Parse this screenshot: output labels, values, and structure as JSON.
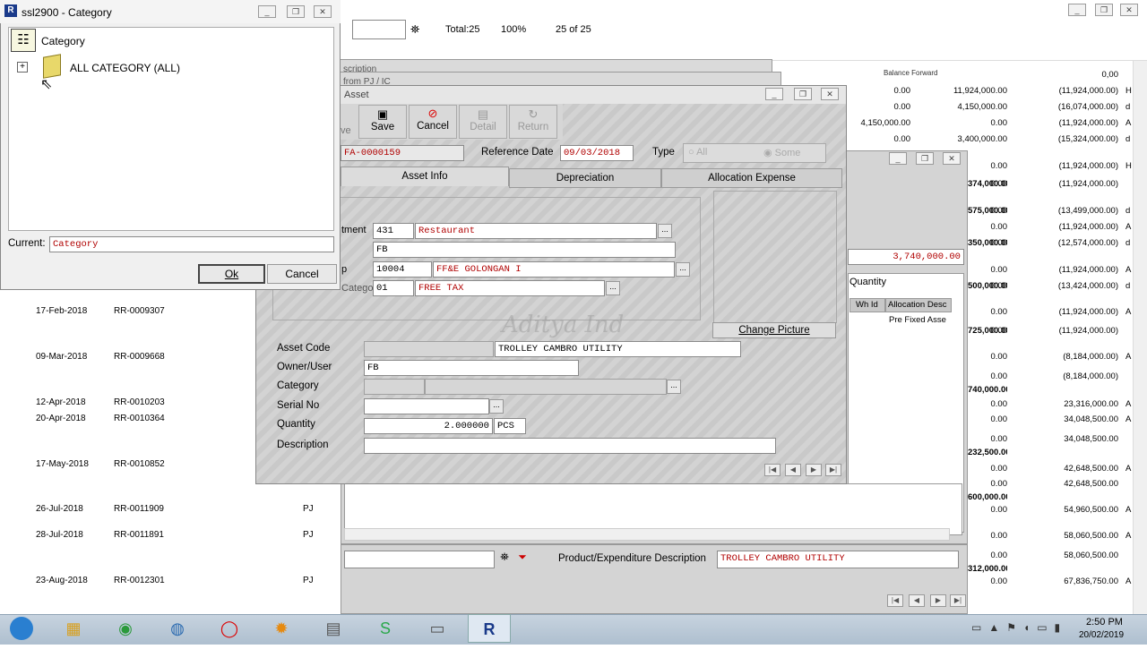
{
  "toolbar": {
    "total": "Total:25",
    "zoom": "100%",
    "page": "25 of 25"
  },
  "category_dialog": {
    "title": "ssl2900 - Category",
    "tree_root": "Category",
    "tree_node": "ALL CATEGORY (ALL)",
    "current_label": "Current:",
    "current_value": "Category",
    "ok": "Ok",
    "cancel": "Cancel"
  },
  "bg_windows": {
    "title1": "scription",
    "title2": "from PJ / IC"
  },
  "asset": {
    "title": "Asset",
    "buttons": {
      "save": "Save",
      "cancel": "Cancel",
      "detail": "Detail",
      "return": "Return",
      "partial": "ve"
    },
    "code": "FA-0000159",
    "ref_date_label": "Reference Date",
    "ref_date": "09/03/2018",
    "type_label": "Type",
    "type_all": "All",
    "type_some": "Some",
    "tabs": [
      "Asset Info",
      "Depreciation",
      "Allocation Expense"
    ],
    "dept_label": "tment",
    "dept_code": "431",
    "dept_name": "Restaurant",
    "row2": "FB",
    "group_label": "p",
    "group_code": "10004",
    "group_name": "FF&E GOLONGAN I",
    "cat_label": "Categor",
    "cat_code": "01",
    "cat_name": "FREE TAX",
    "change_picture": "Change Picture",
    "watermark": "Aditya Ind",
    "asset_code_label": "Asset Code",
    "asset_name": "TROLLEY CAMBRO UTILITY",
    "owner_label": "Owner/User",
    "owner": "FB",
    "category_label": "Category",
    "serial_label": "Serial No",
    "quantity_label": "Quantity",
    "quantity": "2.000000",
    "unit": "PCS",
    "description_label": "Description"
  },
  "detail_window": {
    "value": "3,740,000.00",
    "quantity_col": "Quantity",
    "wh_col": "Wh Id",
    "alloc_col": "Allocation Desc",
    "alloc_value": "Pre Fixed Asse"
  },
  "product_desc": {
    "label": "Product/Expenditure Description",
    "value": "TROLLEY CAMBRO UTILITY"
  },
  "left_rows": [
    {
      "date": "17-Feb-2018",
      "ref": "RR-0009307",
      "type": ""
    },
    {
      "date": "09-Mar-2018",
      "ref": "RR-0009668",
      "type": ""
    },
    {
      "date": "12-Apr-2018",
      "ref": "RR-0010203",
      "type": ""
    },
    {
      "date": "20-Apr-2018",
      "ref": "RR-0010364",
      "type": ""
    },
    {
      "date": "17-May-2018",
      "ref": "RR-0010852",
      "type": ""
    },
    {
      "date": "26-Jul-2018",
      "ref": "RR-0011909",
      "type": "PJ"
    },
    {
      "date": "28-Jul-2018",
      "ref": "RR-0011891",
      "type": "PJ"
    },
    {
      "date": "23-Aug-2018",
      "ref": "RR-0012301",
      "type": "PJ"
    }
  ],
  "right_header": "Balance Forward",
  "right_rows": [
    {
      "a": "",
      "b": "",
      "c": "",
      "d": "0,00",
      "e": ""
    },
    {
      "a": "",
      "b": "0.00",
      "c": "11,924,000.00",
      "d": "(11,924,000.00)",
      "e": "H"
    },
    {
      "a": "",
      "b": "0.00",
      "c": "4,150,000.00",
      "d": "(16,074,000.00)",
      "e": "d"
    },
    {
      "a": "",
      "b": "4,150,000.00",
      "c": "0.00",
      "d": "(11,924,000.00)",
      "e": "A"
    },
    {
      "a": "",
      "b": "0.00",
      "c": "3,400,000.00",
      "d": "(15,324,000.00)",
      "e": "d"
    },
    {
      "a": "",
      "b": "",
      "c": "0.00",
      "d": "(11,924,000.00)",
      "e": "H"
    },
    {
      "a": "374,000.00",
      "b": "",
      "c": "0.00",
      "d": "(11,924,000.00)",
      "e": ""
    },
    {
      "a": "575,000.00",
      "b": "",
      "c": "0.00",
      "d": "(13,499,000.00)",
      "e": "d"
    },
    {
      "a": "",
      "b": "",
      "c": "0.00",
      "d": "(11,924,000.00)",
      "e": "A"
    },
    {
      "a": "350,000.00",
      "b": "",
      "c": "0.00",
      "d": "(12,574,000.00)",
      "e": "d"
    },
    {
      "a": "",
      "b": "",
      "c": "0.00",
      "d": "(11,924,000.00)",
      "e": "A"
    },
    {
      "a": "500,000.00",
      "b": "",
      "c": "0.00",
      "d": "(13,424,000.00)",
      "e": "d"
    },
    {
      "a": "",
      "b": "",
      "c": "0.00",
      "d": "(11,924,000.00)",
      "e": "A"
    },
    {
      "a": "725,000.00",
      "b": "",
      "c": "0.00",
      "d": "(11,924,000.00)",
      "e": ""
    },
    {
      "a": "",
      "b": "",
      "c": "0.00",
      "d": "(8,184,000.00)",
      "e": "A"
    },
    {
      "a": "",
      "b": "",
      "c": "0.00",
      "d": "(8,184,000.00)",
      "e": ""
    },
    {
      "a": "740,000.00",
      "b": "",
      "c": "",
      "d": "",
      "e": ""
    },
    {
      "a": "",
      "b": "",
      "c": "0.00",
      "d": "23,316,000.00",
      "e": "A"
    },
    {
      "a": "",
      "b": "",
      "c": "0.00",
      "d": "34,048,500.00",
      "e": "A"
    },
    {
      "a": "",
      "b": "",
      "c": "0.00",
      "d": "34,048,500.00",
      "e": ""
    },
    {
      "a": "232,500.00",
      "b": "",
      "c": "",
      "d": "",
      "e": ""
    },
    {
      "a": "",
      "b": "",
      "c": "0.00",
      "d": "42,648,500.00",
      "e": "A"
    },
    {
      "a": "",
      "b": "",
      "c": "0.00",
      "d": "42,648,500.00",
      "e": ""
    },
    {
      "a": "600,000.00",
      "b": "",
      "c": "",
      "d": "",
      "e": ""
    },
    {
      "a": "",
      "b": "",
      "c": "0.00",
      "d": "54,960,500.00",
      "e": "A"
    },
    {
      "a": "",
      "b": "",
      "c": "0.00",
      "d": "58,060,500.00",
      "e": "A"
    },
    {
      "a": "",
      "b": "",
      "c": "0.00",
      "d": "58,060,500.00",
      "e": ""
    },
    {
      "a": "312,000.00",
      "b": "",
      "c": "",
      "d": "",
      "e": ""
    },
    {
      "a": "",
      "b": "",
      "c": "0.00",
      "d": "67,836,750.00",
      "e": "A"
    }
  ],
  "taskbar": {
    "time": "2:50 PM",
    "date": "20/02/2019"
  }
}
